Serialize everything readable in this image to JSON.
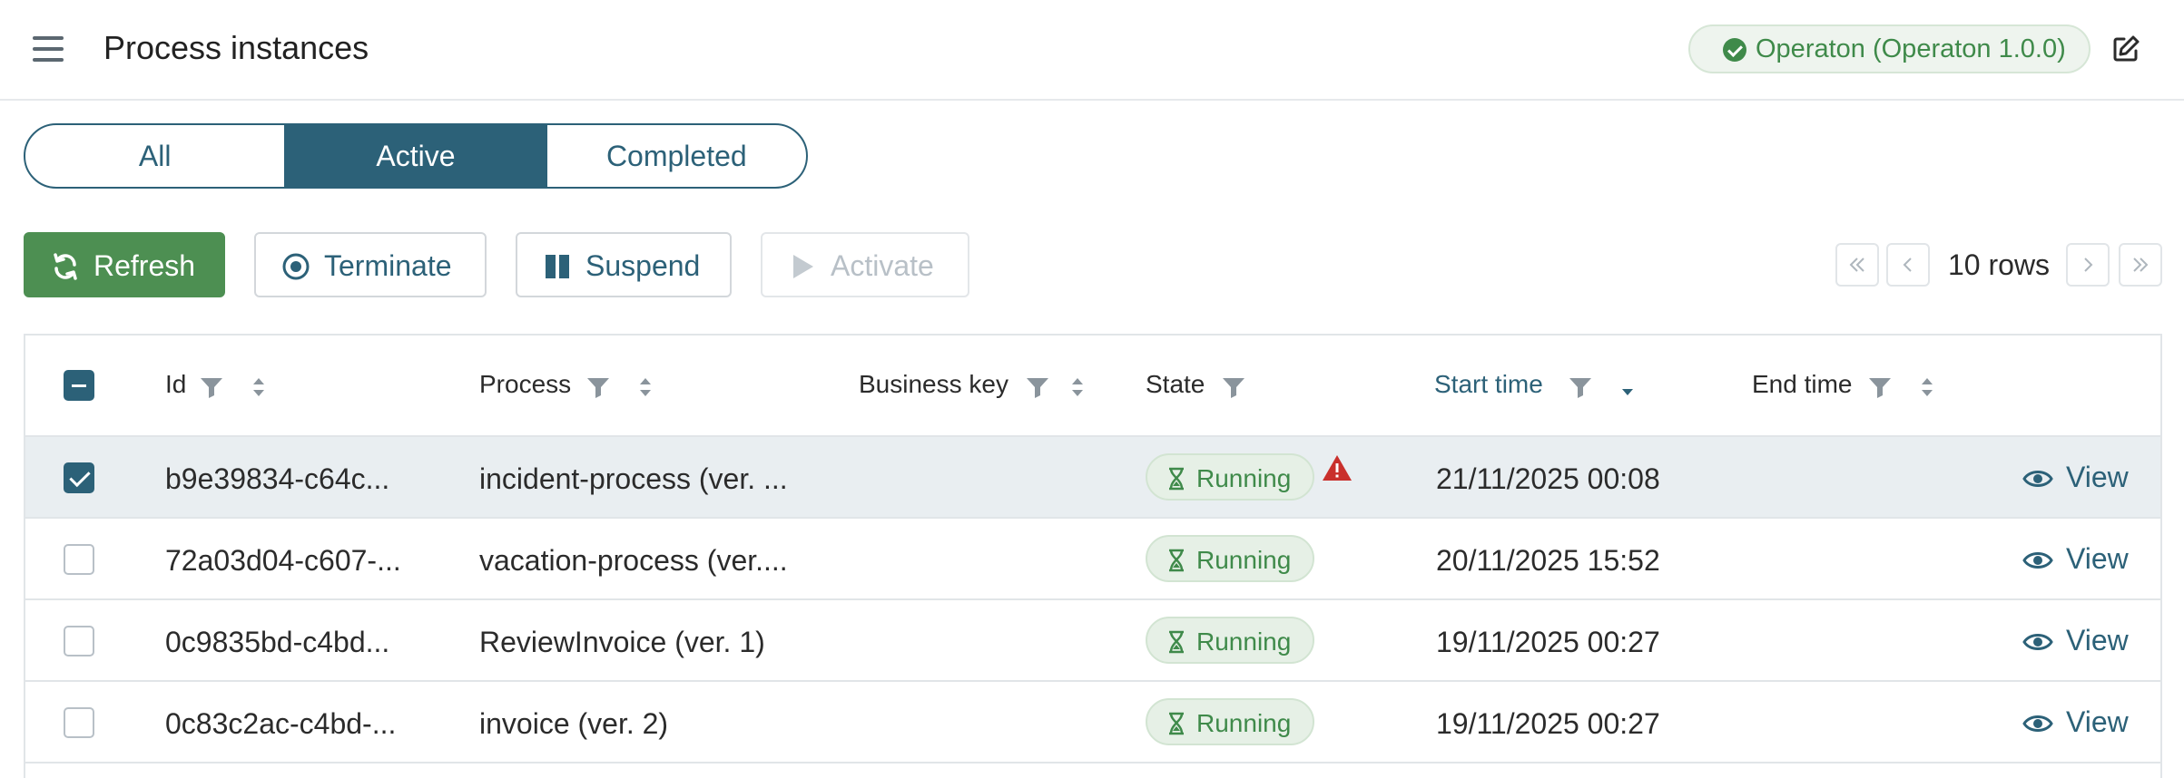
{
  "header": {
    "title": "Process instances",
    "engine_label": "Operaton (Operaton 1.0.0)"
  },
  "tabs": [
    {
      "label": "All",
      "active": false
    },
    {
      "label": "Active",
      "active": true
    },
    {
      "label": "Completed",
      "active": false
    }
  ],
  "toolbar": {
    "refresh_label": "Refresh",
    "terminate_label": "Terminate",
    "suspend_label": "Suspend",
    "activate_label": "Activate"
  },
  "pager": {
    "rows_label": "10 rows"
  },
  "table": {
    "columns": [
      "Id",
      "Process",
      "Business key",
      "State",
      "Start time",
      "End time"
    ],
    "sorted_column": "Start time",
    "rows": [
      {
        "id": "b9e39834-c64c...",
        "process": "incident-process (ver. ...",
        "business_key": "",
        "state": "Running",
        "incident": true,
        "start_time": "21/11/2025 00:08",
        "end_time": "",
        "action": "View",
        "selected": true
      },
      {
        "id": "72a03d04-c607-...",
        "process": "vacation-process (ver....",
        "business_key": "",
        "state": "Running",
        "incident": false,
        "start_time": "20/11/2025 15:52",
        "end_time": "",
        "action": "View",
        "selected": false
      },
      {
        "id": "0c9835bd-c4bd...",
        "process": "ReviewInvoice (ver. 1)",
        "business_key": "",
        "state": "Running",
        "incident": false,
        "start_time": "19/11/2025 00:27",
        "end_time": "",
        "action": "View",
        "selected": false
      },
      {
        "id": "0c83c2ac-c4bd-...",
        "process": "invoice (ver. 2)",
        "business_key": "",
        "state": "Running",
        "incident": false,
        "start_time": "19/11/2025 00:27",
        "end_time": "",
        "action": "View",
        "selected": false
      }
    ]
  },
  "colors": {
    "primary": "#2c6178",
    "success": "#4d8f52",
    "danger": "#c9302c"
  },
  "icons": [
    "menu-icon",
    "check-circle-icon",
    "edit-icon",
    "refresh-icon",
    "stop-circle-icon",
    "pause-icon",
    "play-icon",
    "first-page-icon",
    "prev-page-icon",
    "next-page-icon",
    "last-page-icon",
    "filter-icon",
    "sort-icon",
    "hourglass-icon",
    "warning-icon",
    "eye-icon"
  ]
}
